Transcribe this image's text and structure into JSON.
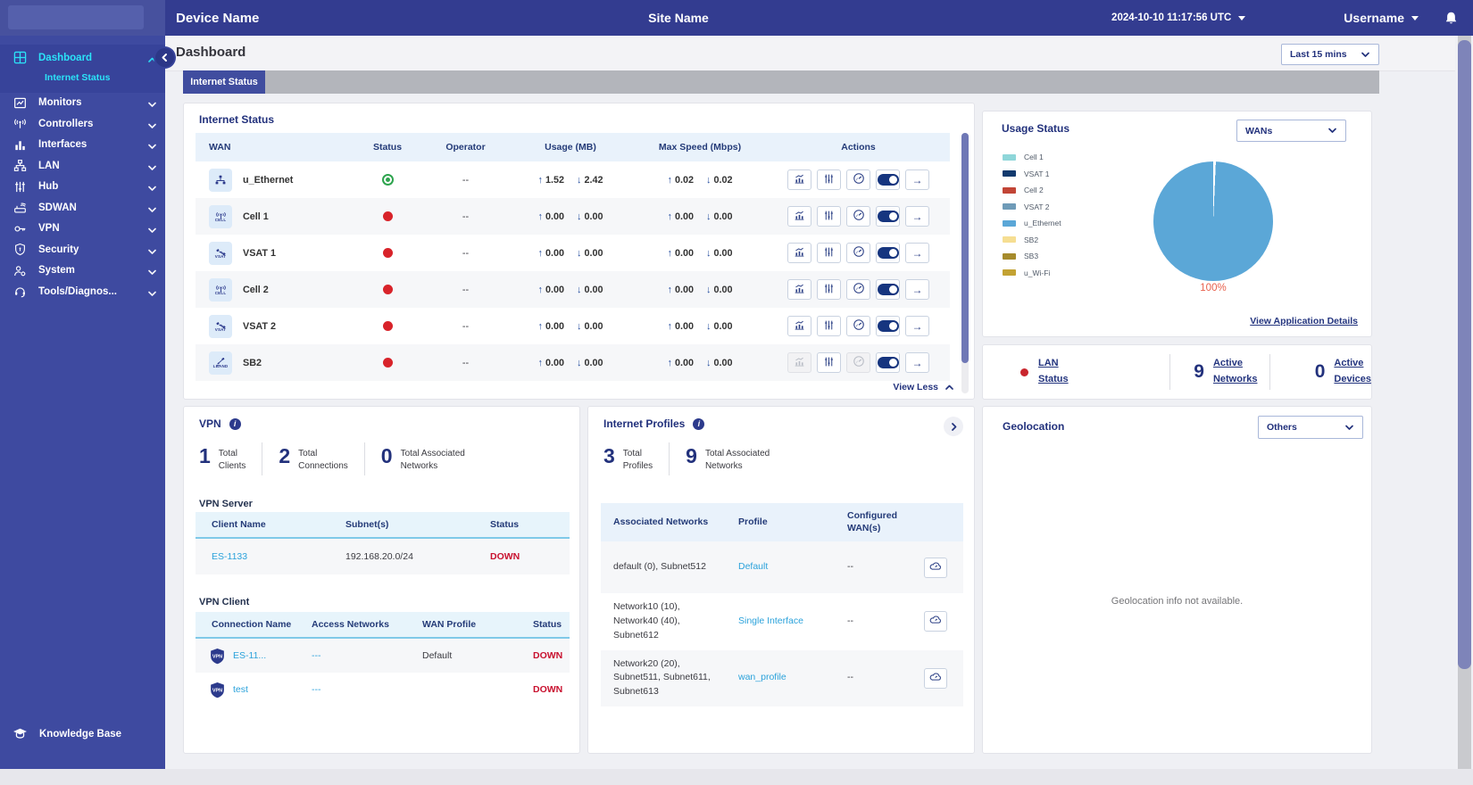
{
  "header": {
    "device_name": "Device Name",
    "site_name": "Site Name",
    "datetime": "2024-10-10 11:17:56 UTC",
    "username": "Username"
  },
  "sidebar": {
    "items": [
      {
        "label": "Dashboard",
        "icon": "dashboard-icon",
        "active": true,
        "expanded": true,
        "children": [
          {
            "label": "Internet Status",
            "active": true
          }
        ]
      },
      {
        "label": "Monitors",
        "icon": "monitors-icon"
      },
      {
        "label": "Controllers",
        "icon": "controllers-icon"
      },
      {
        "label": "Interfaces",
        "icon": "interfaces-icon"
      },
      {
        "label": "LAN",
        "icon": "lan-icon"
      },
      {
        "label": "Hub",
        "icon": "hub-icon"
      },
      {
        "label": "SDWAN",
        "icon": "sdwan-icon"
      },
      {
        "label": "VPN",
        "icon": "vpn-icon"
      },
      {
        "label": "Security",
        "icon": "security-icon"
      },
      {
        "label": "System",
        "icon": "system-icon"
      },
      {
        "label": "Tools/Diagnos...",
        "icon": "tools-icon"
      }
    ],
    "footer_label": "Knowledge Base"
  },
  "page": {
    "title": "Dashboard",
    "time_range": "Last 15 mins",
    "active_tab": "Internet Status"
  },
  "internet_status": {
    "title": "Internet Status",
    "columns": [
      "WAN",
      "Status",
      "Operator",
      "Usage (MB)",
      "Max Speed (Mbps)",
      "Actions"
    ],
    "rows": [
      {
        "wan": "u_Ethernet",
        "icon": "ethernet",
        "badge": "",
        "status": "up",
        "operator": "--",
        "usage_up": "1.52",
        "usage_down": "2.42",
        "speed_up": "0.02",
        "speed_down": "0.02",
        "disabled_actions": []
      },
      {
        "wan": "Cell 1",
        "icon": "cell",
        "badge": "CELL",
        "status": "down",
        "operator": "--",
        "usage_up": "0.00",
        "usage_down": "0.00",
        "speed_up": "0.00",
        "speed_down": "0.00",
        "disabled_actions": []
      },
      {
        "wan": "VSAT 1",
        "icon": "vsat",
        "badge": "VSAT",
        "status": "down",
        "operator": "--",
        "usage_up": "0.00",
        "usage_down": "0.00",
        "speed_up": "0.00",
        "speed_down": "0.00",
        "disabled_actions": []
      },
      {
        "wan": "Cell 2",
        "icon": "cell",
        "badge": "CELL",
        "status": "down",
        "operator": "--",
        "usage_up": "0.00",
        "usage_down": "0.00",
        "speed_up": "0.00",
        "speed_down": "0.00",
        "disabled_actions": []
      },
      {
        "wan": "VSAT 2",
        "icon": "vsat",
        "badge": "VSAT",
        "status": "down",
        "operator": "--",
        "usage_up": "0.00",
        "usage_down": "0.00",
        "speed_up": "0.00",
        "speed_down": "0.00",
        "disabled_actions": []
      },
      {
        "wan": "SB2",
        "icon": "lband",
        "badge": "LBAND",
        "status": "down",
        "operator": "--",
        "usage_up": "0.00",
        "usage_down": "0.00",
        "speed_up": "0.00",
        "speed_down": "0.00",
        "disabled_actions": [
          "chart",
          "gauge"
        ]
      }
    ],
    "actions": [
      "chart",
      "sliders",
      "gauge",
      "toggle",
      "arrow"
    ],
    "view_less_label": "View Less"
  },
  "usage_status": {
    "title": "Usage Status",
    "selector_value": "WANs",
    "legend": [
      {
        "label": "Cell 1",
        "color": "#8ED6D9"
      },
      {
        "label": "VSAT 1",
        "color": "#123A6E"
      },
      {
        "label": "Cell 2",
        "color": "#C24536"
      },
      {
        "label": "VSAT 2",
        "color": "#6F9BB8"
      },
      {
        "label": "u_Ethernet",
        "color": "#5BA7D7"
      },
      {
        "label": "SB2",
        "color": "#F6DE92"
      },
      {
        "label": "SB3",
        "color": "#A68B2C"
      },
      {
        "label": "u_Wi-Fi",
        "color": "#C3A233"
      }
    ],
    "pie": {
      "slices": [
        {
          "label": "u_Ethernet",
          "value": 100,
          "color": "#5BA7D7"
        }
      ],
      "label": "100%",
      "label_color": "#E8604C"
    },
    "details_link": "View Application Details"
  },
  "lan_summary": {
    "status_label": "LAN Status",
    "status_dot_color": "#C9252D",
    "stats": [
      {
        "value": "9",
        "label": "Active Networks"
      },
      {
        "value": "0",
        "label": "Active Devices"
      }
    ]
  },
  "vpn": {
    "title": "VPN",
    "stats": [
      {
        "value": "1",
        "label": "Total Clients"
      },
      {
        "value": "2",
        "label": "Total Connections"
      },
      {
        "value": "0",
        "label": "Total Associated Networks"
      }
    ],
    "server": {
      "title": "VPN Server",
      "columns": [
        "Client Name",
        "Subnet(s)",
        "Status"
      ],
      "rows": [
        {
          "client_name": "ES-1133",
          "subnets": "192.168.20.0/24",
          "status": "DOWN"
        }
      ]
    },
    "client": {
      "title": "VPN Client",
      "columns": [
        "Connection Name",
        "Access Networks",
        "WAN Profile",
        "Status"
      ],
      "rows": [
        {
          "connection_name": "ES-11...",
          "access_networks": "---",
          "wan_profile": "Default",
          "status": "DOWN"
        },
        {
          "connection_name": "test",
          "access_networks": "---",
          "wan_profile": "",
          "status": "DOWN"
        }
      ]
    }
  },
  "internet_profiles": {
    "title": "Internet Profiles",
    "stats": [
      {
        "value": "3",
        "label": "Total Profiles"
      },
      {
        "value": "9",
        "label": "Total Associated Networks"
      }
    ],
    "columns": [
      "Associated Networks",
      "Profile",
      "Configured WAN(s)",
      ""
    ],
    "rows": [
      {
        "networks": "default (0), Subnet512",
        "profile": "Default",
        "wans": "--"
      },
      {
        "networks": "Network10 (10), Network40 (40), Subnet612",
        "profile": "Single Interface",
        "wans": "--"
      },
      {
        "networks": "Network20 (20), Subnet511, Subnet611, Subnet613",
        "profile": "wan_profile",
        "wans": "--"
      }
    ]
  },
  "geolocation": {
    "title": "Geolocation",
    "selector_value": "Others",
    "empty_text": "Geolocation info not available."
  }
}
